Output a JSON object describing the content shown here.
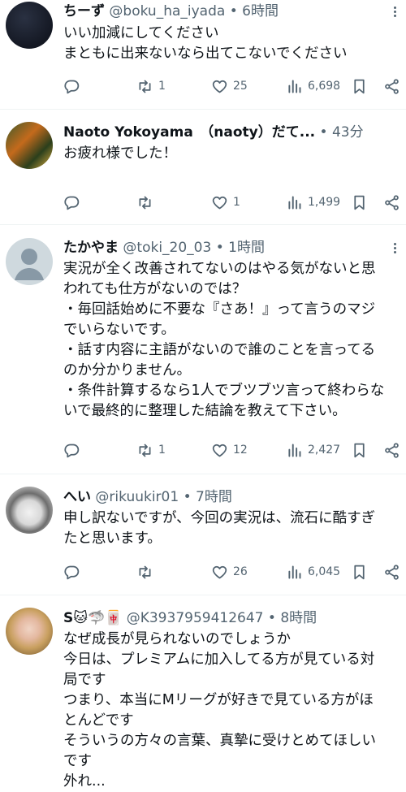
{
  "tweets": [
    {
      "display_name": "ちーず",
      "handle": "@boku_ha_iyada",
      "time": "6時間",
      "lines": [
        "いい加減にしてください",
        "まともに出来ないなら出てこないでください"
      ],
      "reply": "",
      "retweet": "1",
      "like": "25",
      "views": "6,698"
    },
    {
      "display_name": "Naoto Yokoyama　（naoty）だて...",
      "handle": "",
      "time": "43分",
      "lines": [
        "お疲れ様でした！"
      ],
      "reply": "",
      "retweet": "",
      "like": "1",
      "views": "1,499"
    },
    {
      "display_name": "たかやま",
      "handle": "@toki_20_03",
      "time": "1時間",
      "lines": [
        "実況が全く改善されてないのはやる気がないと思",
        "われても仕方がないのでは？",
        "・毎回話始めに不要な『さあ！』って言うのマジ",
        "でいらないです。",
        "・話す内容に主語がないので誰のことを言ってる",
        "のか分かりません。",
        "・条件計算するなら1人でブツブツ言って終わらな",
        "いで最終的に整理した結論を教えて下さい。"
      ],
      "reply": "",
      "retweet": "1",
      "like": "12",
      "views": "2,427"
    },
    {
      "display_name": "へい",
      "handle": "@rikuukir01",
      "time": "7時間",
      "lines": [
        "申し訳ないですが、今回の実況は、流石に酷すぎ",
        "たと思います。"
      ],
      "reply": "",
      "retweet": "",
      "like": "26",
      "views": "6,045"
    },
    {
      "display_name": "S🐱🦈🀄",
      "handle": "@K3937959412647",
      "time": "8時間",
      "lines": [
        "なぜ成長が見られないのでしょうか",
        "今日は、プレミアムに加入してる方が見ている対",
        "局です",
        "つまり、本当にMリーグが好きで見ている方がほ",
        "とんどです",
        "そういうの方々の言葉、真摯に受けとめてほしい",
        "です",
        "外れ..."
      ],
      "reply": "",
      "retweet": "",
      "like": "",
      "views": ""
    }
  ],
  "separator": "•",
  "icons": [
    "reply-icon",
    "retweet-icon",
    "like-icon",
    "views-icon",
    "bookmark-icon",
    "share-icon",
    "more-icon"
  ],
  "colors": {
    "text": "#0f1419",
    "secondary": "#536471",
    "divider": "#eff3f4"
  }
}
